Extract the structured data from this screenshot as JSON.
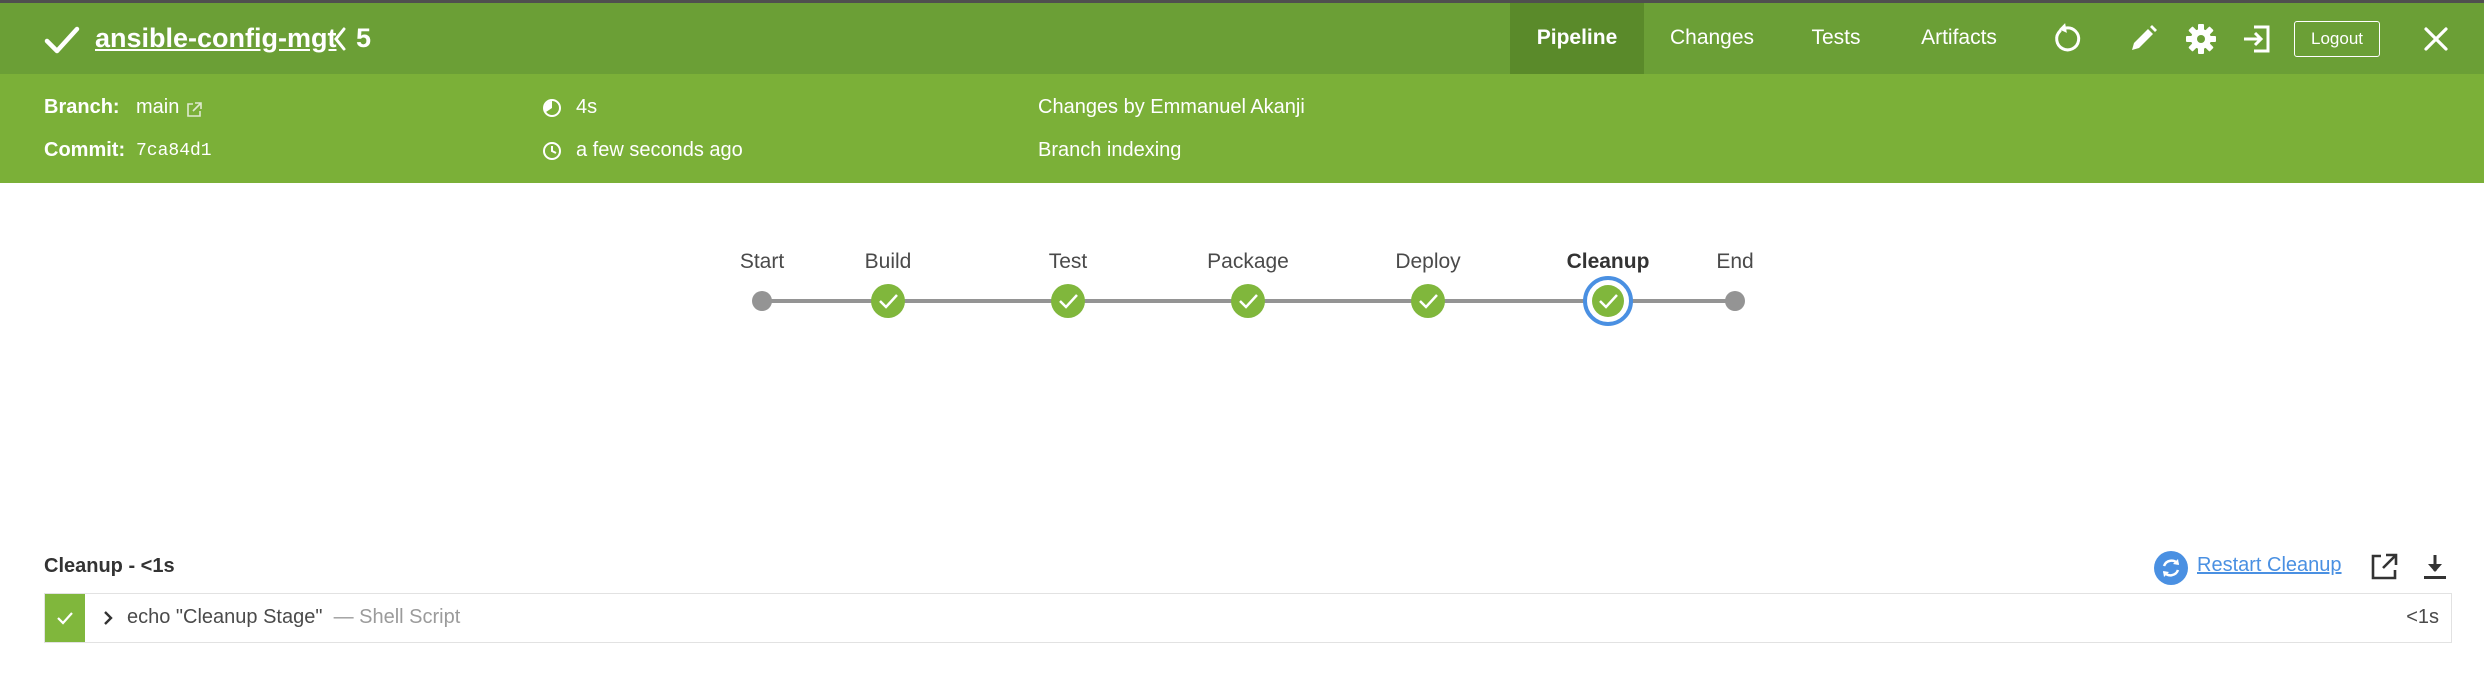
{
  "header": {
    "job_name": "ansible-config-mgt",
    "run_number": "5",
    "tabs": [
      {
        "label": "Pipeline",
        "active": true
      },
      {
        "label": "Changes",
        "active": false
      },
      {
        "label": "Tests",
        "active": false
      },
      {
        "label": "Artifacts",
        "active": false
      }
    ],
    "logout_label": "Logout",
    "icons": [
      "replay-icon",
      "edit-icon",
      "settings-icon",
      "exit-classic-icon",
      "close-icon"
    ]
  },
  "info": {
    "branch_label": "Branch:",
    "branch_value": "main",
    "commit_label": "Commit:",
    "commit_value": "7ca84d1",
    "duration": "4s",
    "time_ago": "a few seconds ago",
    "changes_by": "Changes by Emmanuel Akanji",
    "cause": "Branch indexing"
  },
  "pipeline": {
    "stages": [
      {
        "label": "Start",
        "status": "none"
      },
      {
        "label": "Build",
        "status": "success"
      },
      {
        "label": "Test",
        "status": "success"
      },
      {
        "label": "Package",
        "status": "success"
      },
      {
        "label": "Deploy",
        "status": "success"
      },
      {
        "label": "Cleanup",
        "status": "success",
        "selected": true
      },
      {
        "label": "End",
        "status": "none"
      }
    ]
  },
  "log": {
    "title": "Cleanup - <1s",
    "restart_label": "Restart Cleanup",
    "steps": [
      {
        "command": "echo \"Cleanup Stage\"",
        "type": "— Shell Script",
        "duration": "<1s",
        "status": "success"
      }
    ]
  },
  "colors": {
    "header_bg": "#6b9f36",
    "info_bg": "#7bb038",
    "success": "#80b73c",
    "node_grey": "#949494",
    "selected_ring": "#4a90e2",
    "link_blue": "#4a90e2"
  }
}
